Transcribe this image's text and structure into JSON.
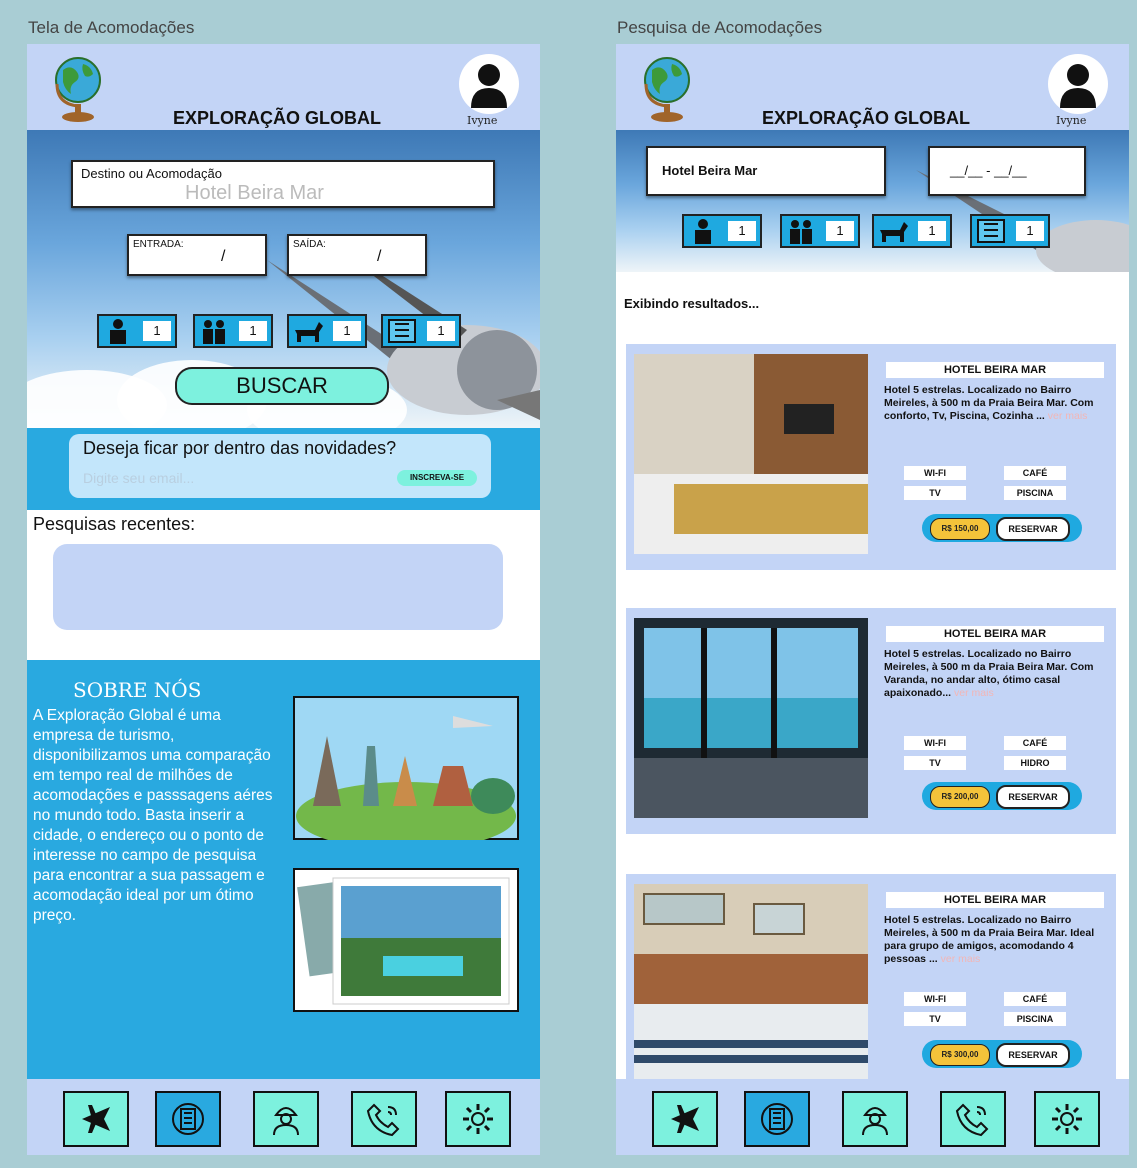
{
  "left": {
    "frame_title": "Tela de Acomodações",
    "brand": "EXPLORAÇÃO GLOBAL",
    "user": "Ivyne",
    "search": {
      "label": "Destino ou Acomodação",
      "placeholder": "Hotel Beira Mar",
      "checkin_label": "ENTRADA:",
      "checkin_value": "/",
      "checkout_label": "SAÍDA:",
      "checkout_value": "/",
      "guests": [
        {
          "icon": "adult-icon",
          "value": "1"
        },
        {
          "icon": "family-icon",
          "value": "1"
        },
        {
          "icon": "pet-icon",
          "value": "1"
        },
        {
          "icon": "room-icon",
          "value": "1"
        }
      ],
      "search_button": "BUSCAR"
    },
    "newsletter": {
      "title": "Deseja ficar por dentro das novidades?",
      "placeholder": "Digite seu email...",
      "subscribe": "INSCREVA-SE"
    },
    "recent_title": "Pesquisas recentes:",
    "about": {
      "title": "SOBRE NÓS",
      "text": "A Exploração Global é uma empresa de turismo, disponibilizamos uma comparação em tempo real de milhões de acomodações e passsagens aéres no mundo todo. Basta inserir a cidade, o endereço ou o ponto de interesse no campo de pesquisa para encontrar a sua passagem e acomodação ideal por um ótimo preço."
    }
  },
  "right": {
    "frame_title": "Pesquisa de Acomodações",
    "brand": "EXPLORAÇÃO GLOBAL",
    "user": "Ivyne",
    "destination": "Hotel Beira Mar",
    "dates": "__/__ - __/__",
    "guests": [
      {
        "icon": "adult-icon",
        "value": "1"
      },
      {
        "icon": "family-icon",
        "value": "1"
      },
      {
        "icon": "pet-icon",
        "value": "1"
      },
      {
        "icon": "room-icon",
        "value": "1"
      }
    ],
    "results_title": "Exibindo resultados...",
    "results": [
      {
        "title": "HOTEL BEIRA MAR",
        "desc": "Hotel 5 estrelas. Localizado no Bairro Meireles, à 500 m da Praia Beira Mar. Com conforto, Tv, Piscina, Cozinha ...",
        "more": "ver mais",
        "amenities": [
          "WI-FI",
          "CAFÉ",
          "TV",
          "PISCINA"
        ],
        "price": "R$ 150,00",
        "reserve": "RESERVAR"
      },
      {
        "title": "HOTEL BEIRA MAR",
        "desc": "Hotel 5 estrelas. Localizado no Bairro Meireles, à 500 m da Praia Beira Mar. Com Varanda, no andar alto, ótimo casal apaixonado...",
        "more": "ver mais",
        "amenities": [
          "WI-FI",
          "CAFÉ",
          "TV",
          "HIDRO"
        ],
        "price": "R$ 200,00",
        "reserve": "RESERVAR"
      },
      {
        "title": "HOTEL BEIRA MAR",
        "desc": "Hotel 5 estrelas. Localizado no Bairro Meireles, à 500 m da Praia Beira Mar. Ideal para grupo de amigos, acomodando 4 pessoas ...",
        "more": "ver mais",
        "amenities": [
          "WI-FI",
          "CAFÉ",
          "TV",
          "PISCINA"
        ],
        "price": "R$ 300,00",
        "reserve": "RESERVAR"
      }
    ]
  },
  "nav": [
    "flights-icon",
    "hotel-icon",
    "guide-icon",
    "contact-icon",
    "settings-icon"
  ],
  "colors": {
    "panel": "#c3d4f6",
    "accent": "#1fa9e0",
    "nav_button": "#7df1de",
    "background": "#a9cdd4"
  }
}
